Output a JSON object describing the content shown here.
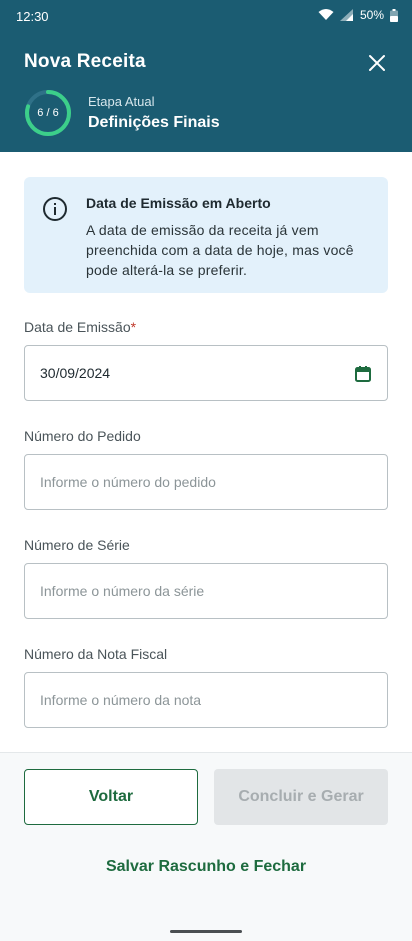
{
  "status_bar": {
    "time": "12:30",
    "battery": "50%"
  },
  "header": {
    "title": "Nova Receita",
    "progress_text": "6 / 6",
    "progress_fraction": 1.0,
    "stage_label": "Etapa Atual",
    "stage_value": "Definições Finais",
    "icons": {
      "close": "close-icon"
    }
  },
  "info": {
    "title": "Data de Emissão em Aberto",
    "body": "A data de emissão da receita já vem preenchida com a data de hoje, mas você pode alterá-la se preferir.",
    "icon": "info-icon"
  },
  "form": {
    "emission_date": {
      "label": "Data de Emissão",
      "required_mark": "*",
      "value": "30/09/2024"
    },
    "order_number": {
      "label": "Número do Pedido",
      "placeholder": "Informe o número do pedido"
    },
    "series_number": {
      "label": "Número de Série",
      "placeholder": "Informe o número da série"
    },
    "invoice_number": {
      "label": "Número da Nota Fiscal",
      "placeholder": "Informe o número da nota"
    }
  },
  "footer": {
    "back_label": "Voltar",
    "finish_label": "Concluir e Gerar",
    "save_label": "Salvar Rascunho e Fechar"
  },
  "colors": {
    "header_bg": "#1b5c72",
    "progress_ring": "#3ccf8a",
    "info_bg": "#e3f1fb",
    "primary_green": "#1e6b3f",
    "disabled_bg": "#e2e5e7"
  }
}
